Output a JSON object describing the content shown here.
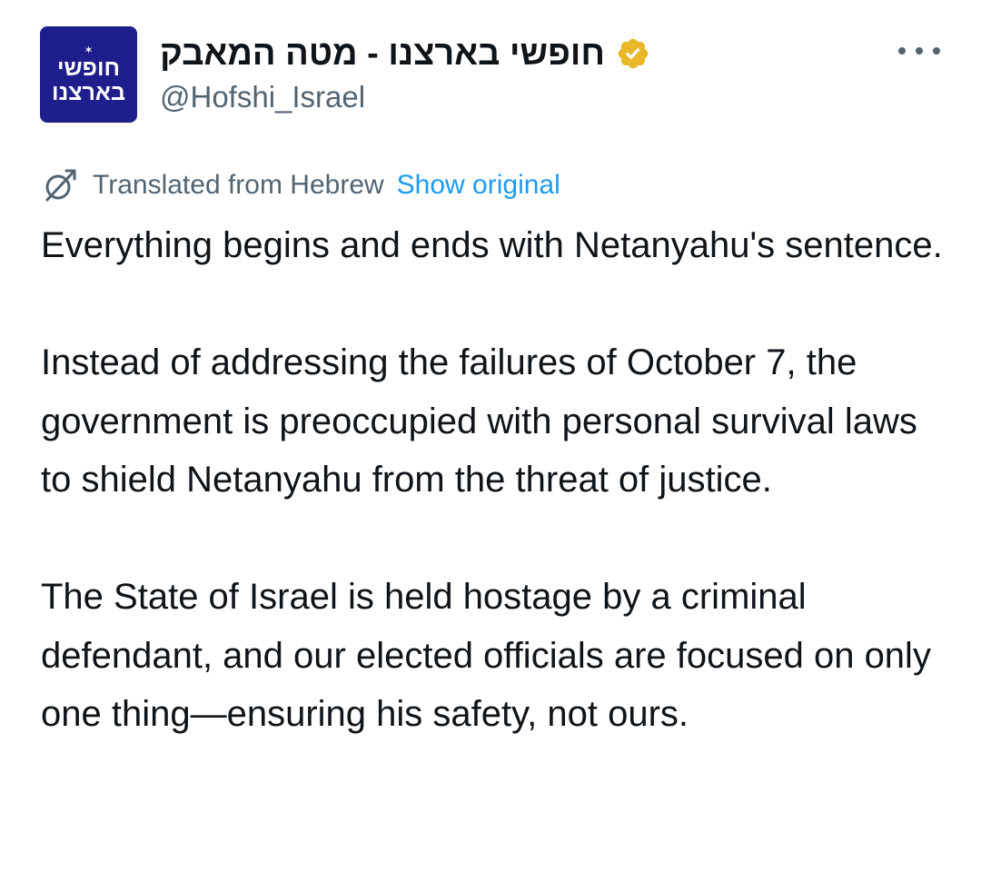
{
  "author": {
    "avatar_line1": "חופשי",
    "avatar_line2": "בארצנו",
    "avatar_star": "✶",
    "display_name": "חופשי בארצנו - מטה המאבק",
    "handle": "@Hofshi_Israel",
    "avatar_color": "#1e1f8c",
    "verified_color": "#e8b829"
  },
  "menu": {
    "more_icon": "more-horizontal-icon"
  },
  "translation": {
    "icon": "translate-icon",
    "label": "Translated from Hebrew",
    "show_original": "Show original",
    "link_color": "#1d9bf0"
  },
  "body": {
    "paragraphs": [
      "Everything begins and ends with Netanyahu's sentence.",
      "Instead of addressing the failures of October 7, the government is preoccupied with personal survival laws to shield Netanyahu from the threat of justice.",
      "The State of Israel is held hostage by a criminal defendant, and our elected officials are focused on only one thing—ensuring his safety, not ours."
    ]
  }
}
